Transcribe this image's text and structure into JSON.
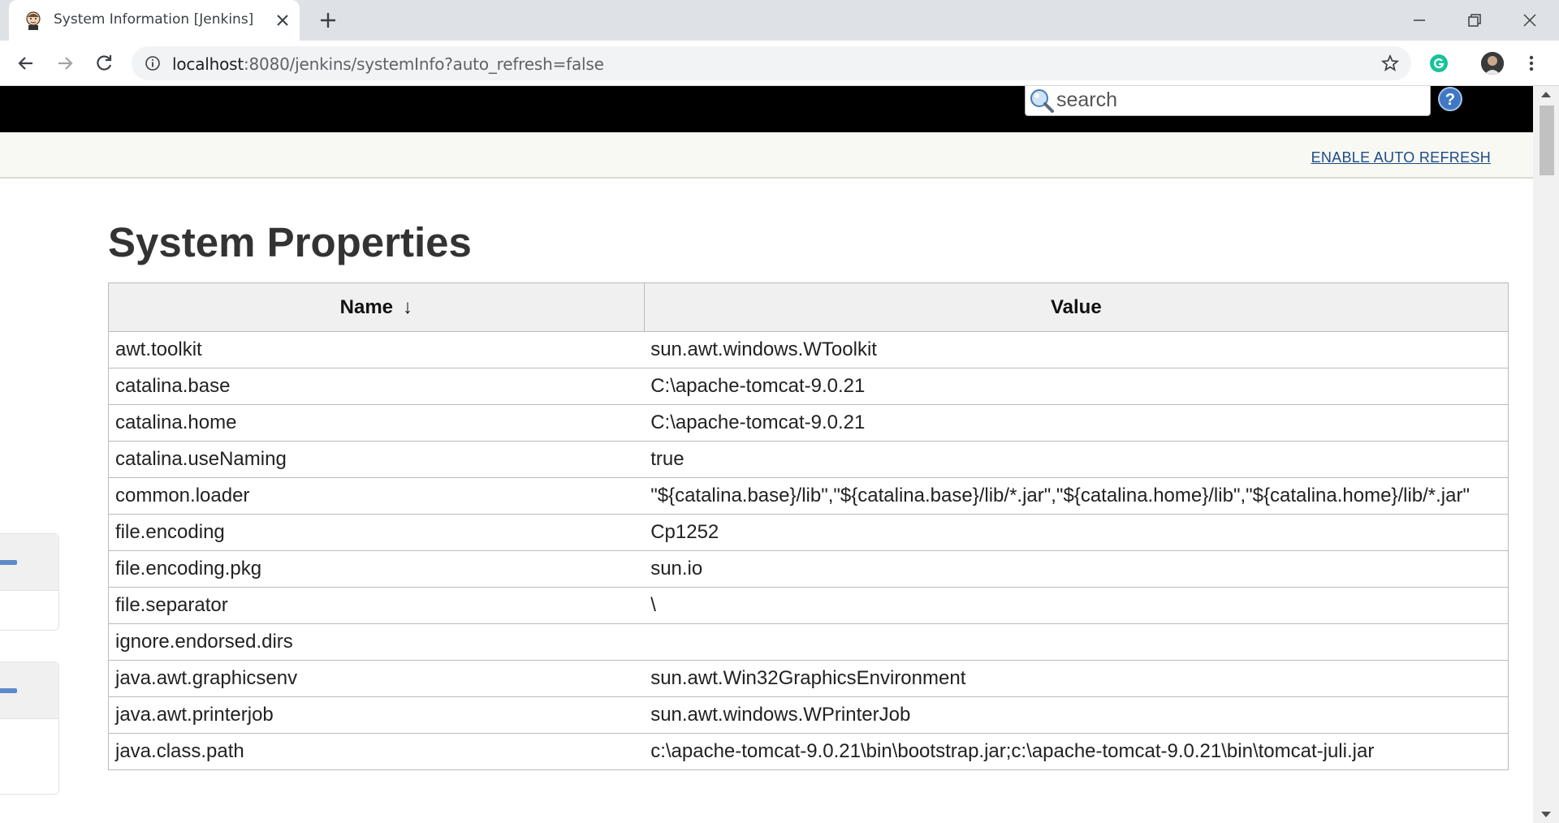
{
  "browser": {
    "tab_title": "System Information [Jenkins]",
    "url_host": "localhost",
    "url_rest": ":8080/jenkins/systemInfo?auto_refresh=false"
  },
  "header": {
    "search_placeholder": "search"
  },
  "breadcrumb": {
    "auto_refresh_link": "ENABLE AUTO REFRESH"
  },
  "main": {
    "title": "System Properties",
    "table": {
      "columns": [
        "Name",
        "Value"
      ],
      "sort_indicator": "↓",
      "rows": [
        {
          "name": "awt.toolkit",
          "value": "sun.awt.windows.WToolkit"
        },
        {
          "name": "catalina.base",
          "value": "C:\\apache-tomcat-9.0.21"
        },
        {
          "name": "catalina.home",
          "value": "C:\\apache-tomcat-9.0.21"
        },
        {
          "name": "catalina.useNaming",
          "value": "true"
        },
        {
          "name": "common.loader",
          "value": "\"${catalina.base}/lib\",\"${catalina.base}/lib/*.jar\",\"${catalina.home}/lib\",\"${catalina.home}/lib/*.jar\""
        },
        {
          "name": "file.encoding",
          "value": "Cp1252"
        },
        {
          "name": "file.encoding.pkg",
          "value": "sun.io"
        },
        {
          "name": "file.separator",
          "value": "\\"
        },
        {
          "name": "ignore.endorsed.dirs",
          "value": ""
        },
        {
          "name": "java.awt.graphicsenv",
          "value": "sun.awt.Win32GraphicsEnvironment"
        },
        {
          "name": "java.awt.printerjob",
          "value": "sun.awt.windows.WPrinterJob"
        },
        {
          "name": "java.class.path",
          "value": "c:\\apache-tomcat-9.0.21\\bin\\bootstrap.jar;c:\\apache-tomcat-9.0.21\\bin\\tomcat-juli.jar"
        }
      ]
    }
  },
  "colors": {
    "header_bg": "#000000",
    "breadcrumb_bg": "#f7f9f2",
    "link": "#204a87",
    "table_header_bg": "#f0f0f0"
  },
  "icons": [
    "jenkins-favicon-icon",
    "close-icon",
    "plus-icon",
    "minimize-icon",
    "restore-icon",
    "window-close-icon",
    "back-arrow-icon",
    "forward-arrow-icon",
    "reload-icon",
    "info-icon",
    "star-icon",
    "grammarly-icon",
    "profile-avatar",
    "more-vert-icon",
    "search-icon",
    "help-icon",
    "collapse-icon"
  ]
}
